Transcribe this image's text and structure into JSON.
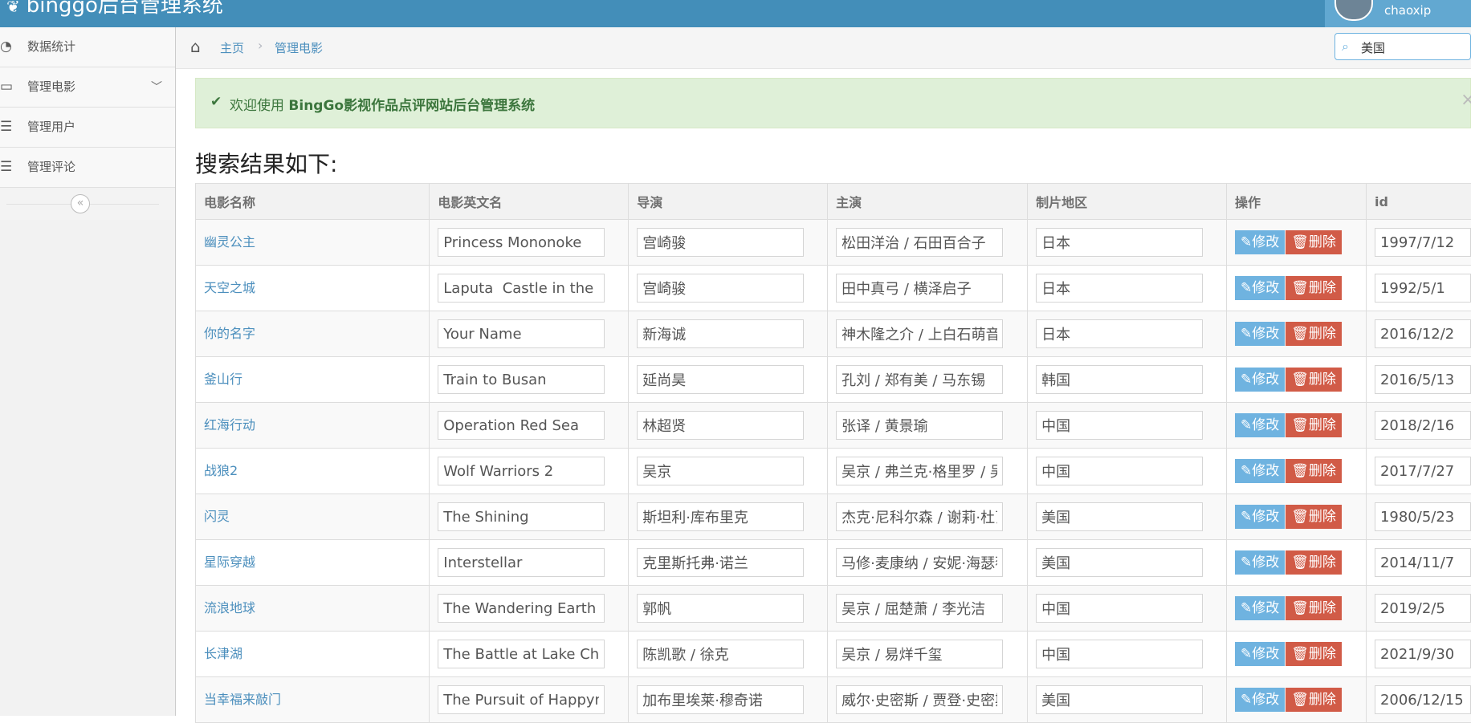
{
  "app": {
    "brand": "binggo后台管理系统",
    "user_name": "chaoxip"
  },
  "sidebar": {
    "items": [
      {
        "label": "数据统计",
        "icon": "dashboard-icon"
      },
      {
        "label": "管理电影",
        "icon": "desktop-icon"
      },
      {
        "label": "管理用户",
        "icon": "list-icon"
      },
      {
        "label": "管理评论",
        "icon": "list-icon"
      }
    ],
    "collapse_glyph": "«"
  },
  "breadcrumb": {
    "home": "主页",
    "current": "管理电影"
  },
  "search": {
    "value": "美国"
  },
  "alert": {
    "prefix": "欢迎使用 ",
    "strong": "BingGo影视作品点评网站后台管理系统"
  },
  "page_title": "搜索结果如下:",
  "table": {
    "headers": [
      "电影名称",
      "电影英文名",
      "导演",
      "主演",
      "制片地区",
      "操作",
      "id"
    ],
    "edit_label": "修改",
    "delete_label": "删除",
    "rows": [
      {
        "name": "幽灵公主",
        "en": "Princess Mononoke",
        "director": "宫崎骏",
        "actors": "松田洋治 / 石田百合子",
        "region": "日本",
        "date": "1997/7/12"
      },
      {
        "name": "天空之城",
        "en": "Laputa  Castle in the Sky",
        "director": "宫崎骏",
        "actors": "田中真弓 / 横泽启子",
        "region": "日本",
        "date": "1992/5/1"
      },
      {
        "name": "你的名字",
        "en": "Your Name",
        "director": "新海诚",
        "actors": "神木隆之介 / 上白石萌音",
        "region": "日本",
        "date": "2016/12/2"
      },
      {
        "name": "釜山行",
        "en": "Train to Busan",
        "director": "延尚昊",
        "actors": "孔刘 / 郑有美 / 马东锡",
        "region": "韩国",
        "date": "2016/5/13"
      },
      {
        "name": "红海行动",
        "en": "Operation Red Sea",
        "director": "林超贤",
        "actors": "张译 / 黄景瑜",
        "region": "中国",
        "date": "2018/2/16"
      },
      {
        "name": "战狼2",
        "en": "Wolf Warriors 2",
        "director": "吴京",
        "actors": "吴京 / 弗兰克·格里罗 / 吴",
        "region": "中国",
        "date": "2017/7/27"
      },
      {
        "name": "闪灵",
        "en": "The Shining",
        "director": "斯坦利·库布里克",
        "actors": "杰克·尼科尔森 / 谢莉·杜瓦",
        "region": "美国",
        "date": "1980/5/23"
      },
      {
        "name": "星际穿越",
        "en": "Interstellar",
        "director": "克里斯托弗·诺兰",
        "actors": "马修·麦康纳 / 安妮·海瑟薇",
        "region": "美国",
        "date": "2014/11/7"
      },
      {
        "name": "流浪地球",
        "en": "The Wandering Earth",
        "director": "郭帆",
        "actors": "吴京 / 屈楚萧 / 李光洁",
        "region": "中国",
        "date": "2019/2/5"
      },
      {
        "name": "长津湖",
        "en": "The Battle at Lake Changjin",
        "director": "陈凯歌 / 徐克",
        "actors": "吴京 / 易烊千玺",
        "region": "中国",
        "date": "2021/9/30"
      },
      {
        "name": "当幸福来敲门",
        "en": "The Pursuit of Happyness",
        "director": "加布里埃莱·穆奇诺",
        "actors": "威尔·史密斯 / 贾登·史密斯",
        "region": "美国",
        "date": "2006/12/15"
      }
    ]
  },
  "colors": {
    "navbar": "#438eb9",
    "link": "#4c8fbd",
    "edit": "#6fb3e0",
    "delete": "#d15b47",
    "alert_bg": "#dff0d8"
  }
}
